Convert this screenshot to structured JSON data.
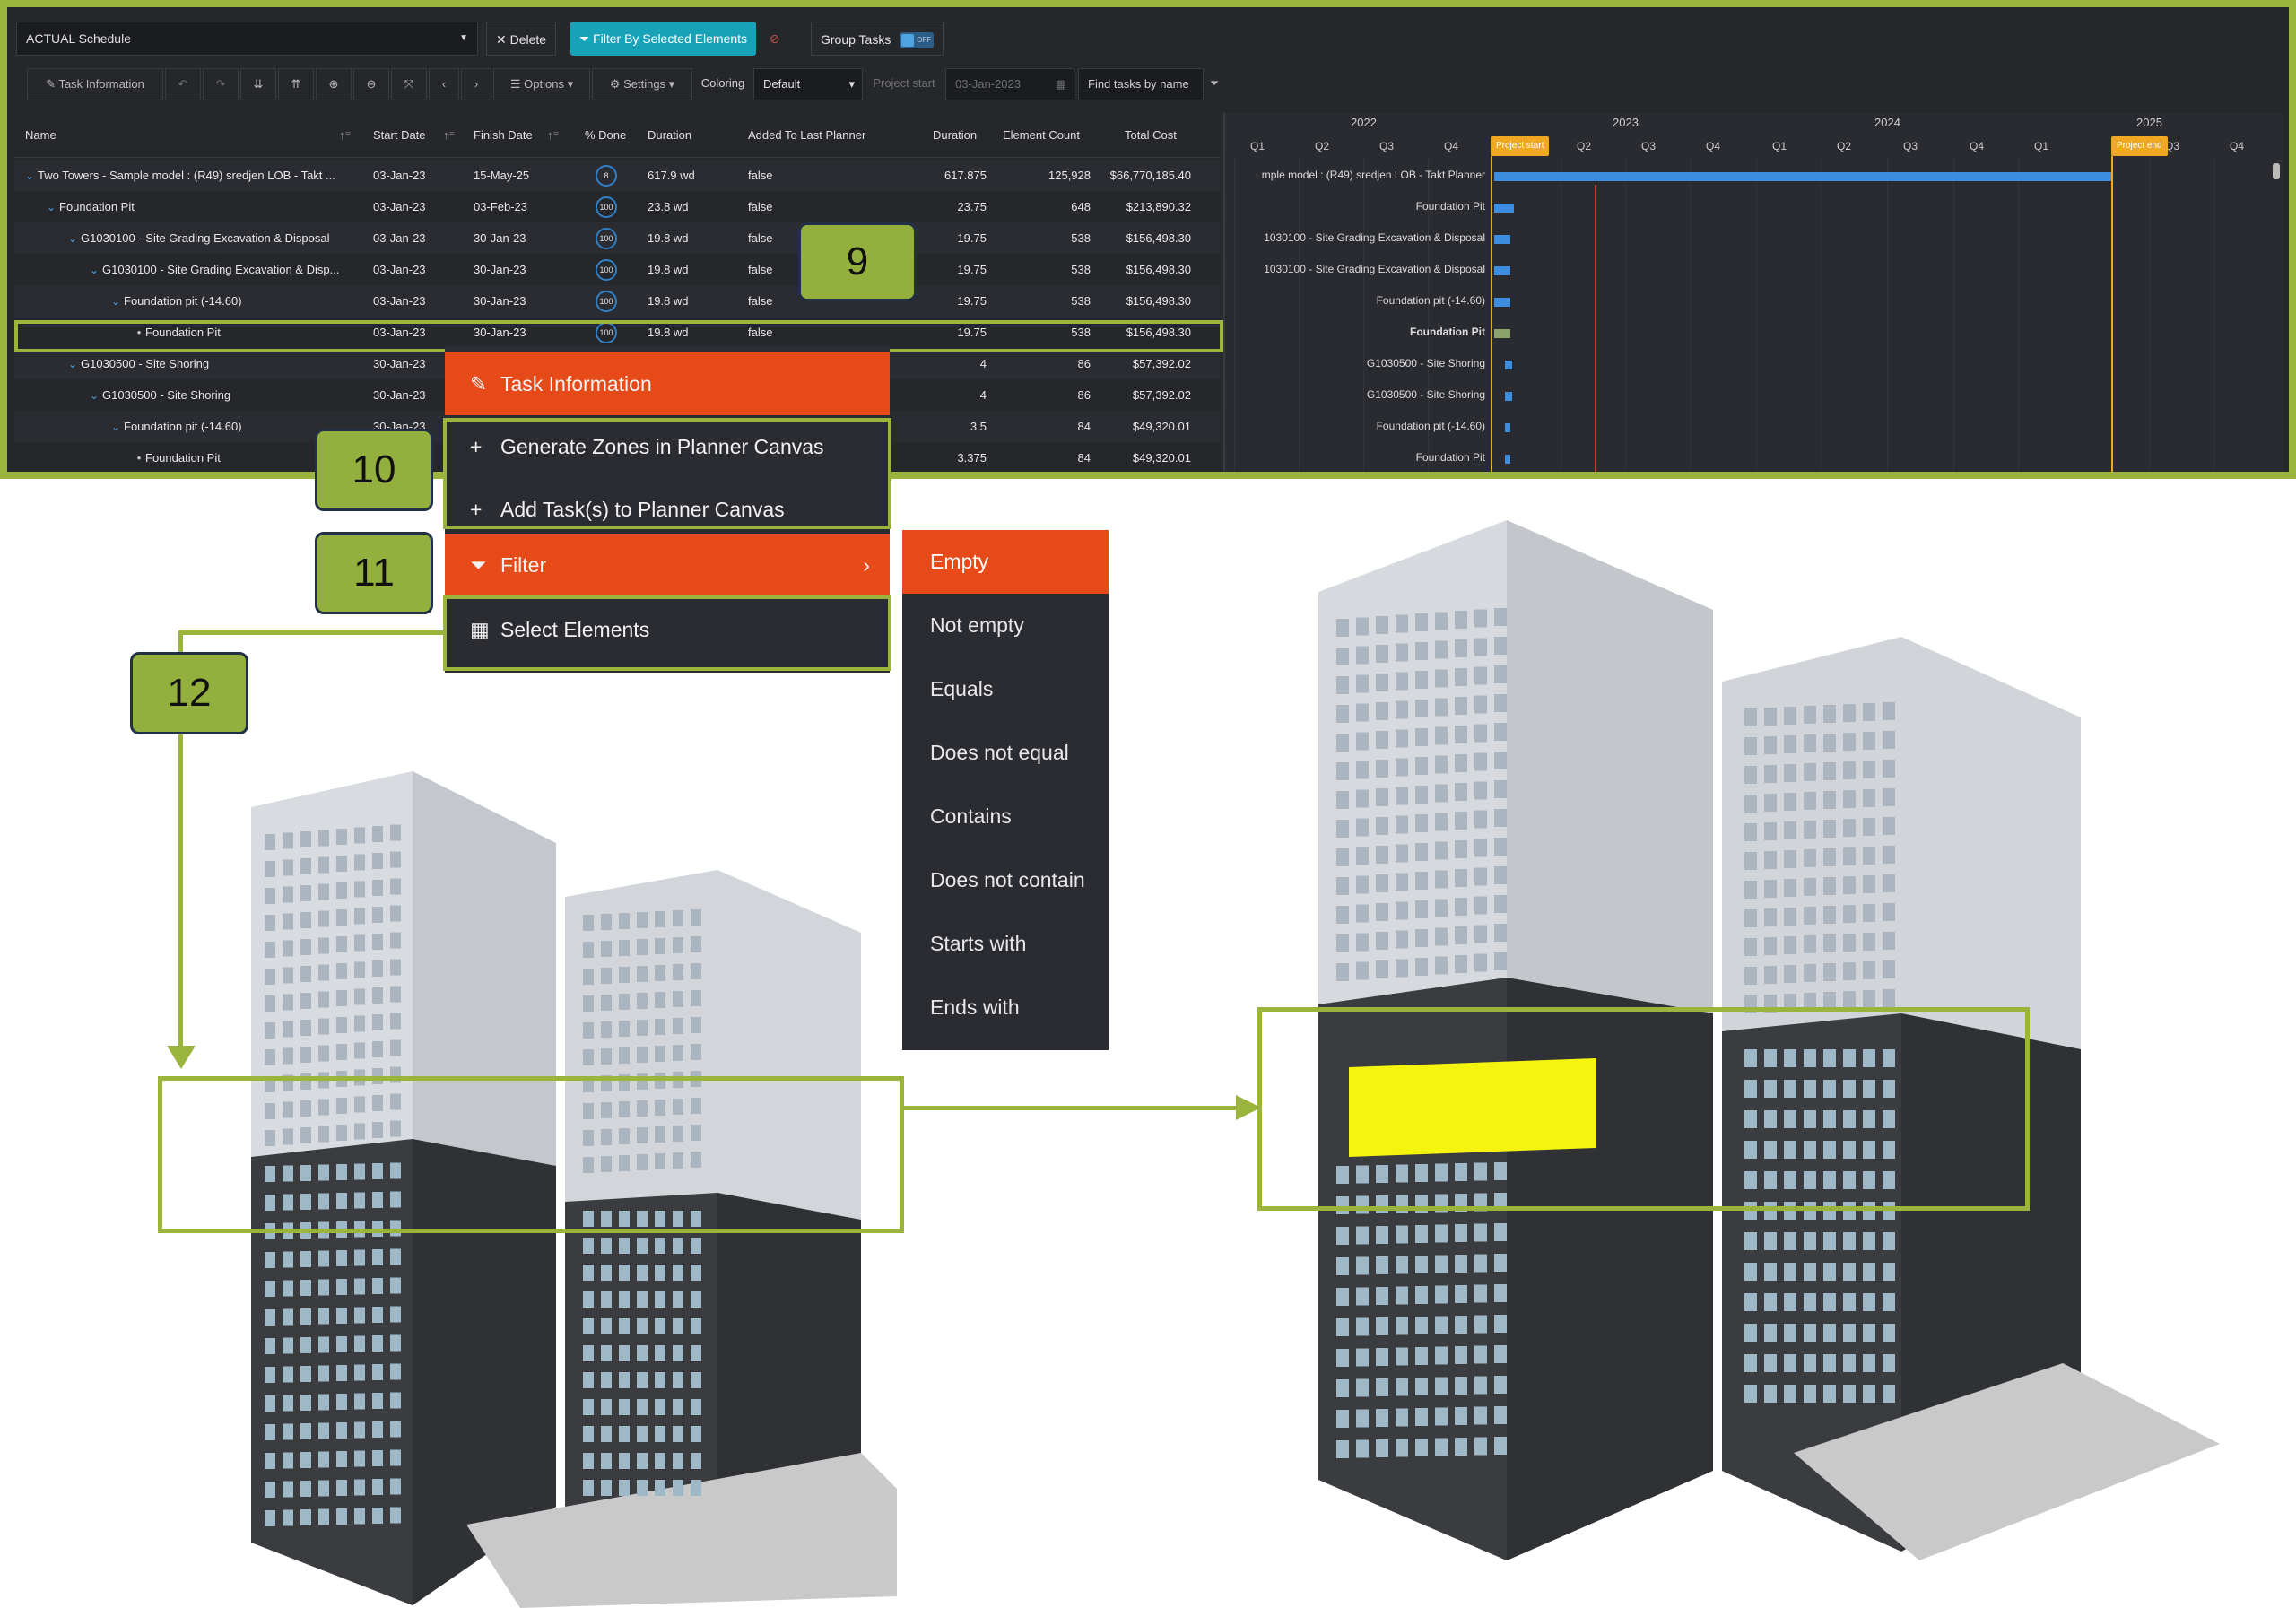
{
  "toolbar1": {
    "schedule_name": "ACTUAL Schedule",
    "delete_label": "Delete",
    "filter_selected_label": "Filter By Selected Elements",
    "group_tasks_label": "Group Tasks",
    "group_tasks_state": "OFF"
  },
  "toolbar2": {
    "task_info_label": "Task Information",
    "options_label": "Options",
    "settings_label": "Settings",
    "coloring_label": "Coloring",
    "coloring_value": "Default",
    "project_start_label": "Project start",
    "project_start_value": "03-Jan-2023",
    "find_tasks_placeholder": "Find tasks by name"
  },
  "columns": [
    "Name",
    "Start Date",
    "Finish Date",
    "% Done",
    "Duration",
    "Added To Last Planner",
    "Duration",
    "Element Count",
    "Total Cost"
  ],
  "rows": [
    {
      "name": "Two Towers - Sample model : (R49) sredjen LOB - Takt ...",
      "start": "03-Jan-23",
      "finish": "15-May-25",
      "done": "8",
      "duration": "617.9 wd",
      "added": "false",
      "dur2": "617.875",
      "count": "125,928",
      "cost": "$66,770,185.40"
    },
    {
      "name": "Foundation Pit",
      "start": "03-Jan-23",
      "finish": "03-Feb-23",
      "done": "100",
      "duration": "23.8 wd",
      "added": "false",
      "dur2": "23.75",
      "count": "648",
      "cost": "$213,890.32"
    },
    {
      "name": "G1030100 - Site Grading Excavation & Disposal",
      "start": "03-Jan-23",
      "finish": "30-Jan-23",
      "done": "100",
      "duration": "19.8 wd",
      "added": "false",
      "dur2": "19.75",
      "count": "538",
      "cost": "$156,498.30"
    },
    {
      "name": "G1030100 - Site Grading Excavation & Disp...",
      "start": "03-Jan-23",
      "finish": "30-Jan-23",
      "done": "100",
      "duration": "19.8 wd",
      "added": "false",
      "dur2": "19.75",
      "count": "538",
      "cost": "$156,498.30"
    },
    {
      "name": "Foundation pit (-14.60)",
      "start": "03-Jan-23",
      "finish": "30-Jan-23",
      "done": "100",
      "duration": "19.8 wd",
      "added": "false",
      "dur2": "19.75",
      "count": "538",
      "cost": "$156,498.30"
    },
    {
      "name": "Foundation Pit",
      "start": "03-Jan-23",
      "finish": "30-Jan-23",
      "done": "100",
      "duration": "19.8 wd",
      "added": "false",
      "dur2": "19.75",
      "count": "538",
      "cost": "$156,498.30"
    },
    {
      "name": "G1030500 - Site Shoring",
      "start": "30-Jan-23",
      "finish": "",
      "done": "",
      "duration": "",
      "added": "",
      "dur2": "4",
      "count": "86",
      "cost": "$57,392.02"
    },
    {
      "name": "G1030500 - Site Shoring",
      "start": "30-Jan-23",
      "finish": "",
      "done": "",
      "duration": "",
      "added": "",
      "dur2": "4",
      "count": "86",
      "cost": "$57,392.02"
    },
    {
      "name": "Foundation pit (-14.60)",
      "start": "30-Jan-23",
      "finish": "",
      "done": "",
      "duration": "",
      "added": "",
      "dur2": "3.5",
      "count": "84",
      "cost": "$49,320.01"
    },
    {
      "name": "Foundation Pit",
      "start": "30-Jan-23",
      "finish": "",
      "done": "",
      "duration": "",
      "added": "",
      "dur2": "3.375",
      "count": "84",
      "cost": "$49,320.01"
    }
  ],
  "gantt": {
    "years": [
      "2022",
      "2023",
      "2024",
      "2025"
    ],
    "quarters": [
      "Q1",
      "Q2",
      "Q3",
      "Q4",
      "Q2",
      "Q3",
      "Q4",
      "Q1",
      "Q2",
      "Q3",
      "Q4",
      "Q1",
      "Q3",
      "Q4"
    ],
    "project_start": "Project start",
    "project_end": "Project end",
    "labels": [
      "mple model : (R49) sredjen LOB - Takt Planner",
      "Foundation Pit",
      "1030100 - Site Grading Excavation & Disposal",
      "1030100 - Site Grading Excavation & Disposal",
      "Foundation pit (-14.60)",
      "Foundation Pit",
      "G1030500 - Site Shoring",
      "G1030500 - Site Shoring",
      "Foundation pit (-14.60)",
      "Foundation Pit"
    ]
  },
  "callouts": {
    "nine": "9",
    "ten": "10",
    "eleven": "11",
    "twelve": "12"
  },
  "context_menu": {
    "task_info": "Task Information",
    "generate_zones": "Generate Zones in Planner Canvas",
    "add_tasks": "Add Task(s) to Planner Canvas",
    "filter": "Filter",
    "select_elements": "Select Elements"
  },
  "filter_submenu": [
    "Empty",
    "Not empty",
    "Equals",
    "Does not equal",
    "Contains",
    "Does not contain",
    "Starts with",
    "Ends with"
  ],
  "colors": {
    "accent_green": "#9ab43c",
    "menu_orange": "#e64a19",
    "teal": "#17a2b8",
    "highlight_yellow": "#f4f40f"
  }
}
